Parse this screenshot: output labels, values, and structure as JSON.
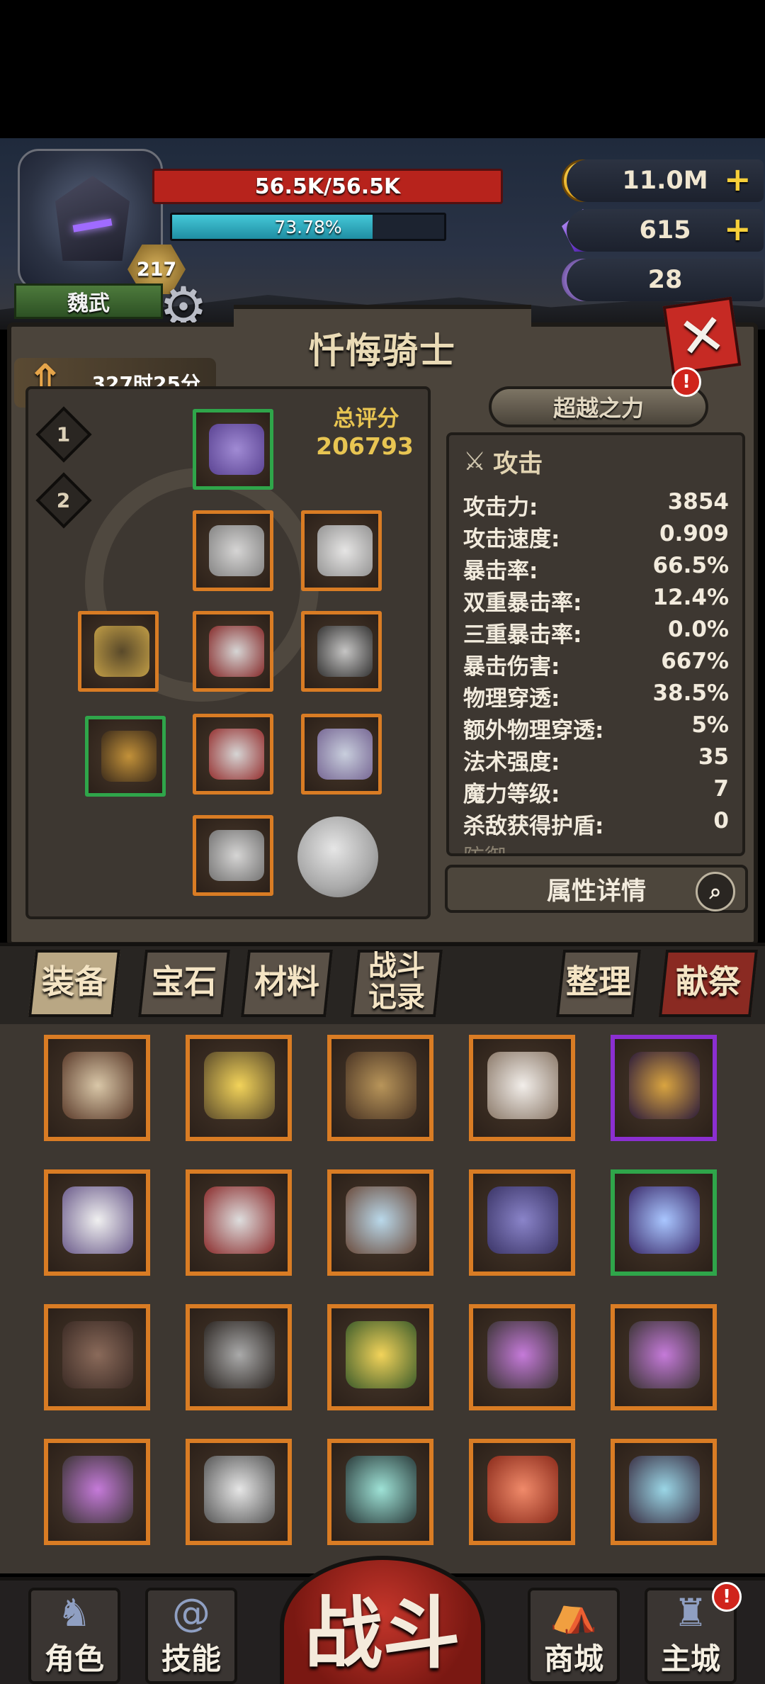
{
  "player": {
    "name": "魏武",
    "level": "217",
    "hp": "56.5K/56.5K",
    "exp_text": "73.78%",
    "exp_fraction": 0.7378
  },
  "currencies": [
    {
      "icon": "gold-coin-icon",
      "value": "11.0M",
      "has_plus": true
    },
    {
      "icon": "purple-gem-icon",
      "value": "615",
      "has_plus": true
    },
    {
      "icon": "ram-skull-icon",
      "value": "28",
      "has_plus": false
    }
  ],
  "panel": {
    "title": "忏悔骑士",
    "timer": "327时25分",
    "loadouts": [
      "1",
      "2"
    ],
    "score_label": "总评分",
    "score_value": "206793",
    "transcend_label": "超越之力",
    "alert_symbol": "!"
  },
  "stats": {
    "header": "攻击",
    "rows": [
      {
        "label": "攻击力:",
        "value": "3854"
      },
      {
        "label": "攻击速度:",
        "value": "0.909"
      },
      {
        "label": "暴击率:",
        "value": "66.5%"
      },
      {
        "label": "双重暴击率:",
        "value": "12.4%"
      },
      {
        "label": "三重暴击率:",
        "value": "0.0%"
      },
      {
        "label": "暴击伤害:",
        "value": "667%"
      },
      {
        "label": "物理穿透:",
        "value": "38.5%"
      },
      {
        "label": "额外物理穿透:",
        "value": "5%"
      },
      {
        "label": "法术强度:",
        "value": "35"
      },
      {
        "label": "魔力等级:",
        "value": "7"
      },
      {
        "label": "杀敌获得护盾:",
        "value": "0"
      }
    ],
    "next_section_partial": "防御",
    "details_label": "属性详情"
  },
  "tabs": {
    "equip": "装备",
    "gems": "宝石",
    "materials": "材料",
    "battle_record": "战斗\n记录",
    "sort": "整理",
    "sacrifice": "献祭"
  },
  "nav": {
    "character": "角色",
    "skills": "技能",
    "battle": "战斗",
    "shop": "商城",
    "main_city": "主城"
  },
  "colors": {
    "hp": "#b7231c",
    "exp": "#1f8ea3",
    "gold_text": "#e8c552",
    "orange_frame": "#d97c24",
    "green_frame": "#2fa54a",
    "purple_frame": "#8b2fd1"
  }
}
